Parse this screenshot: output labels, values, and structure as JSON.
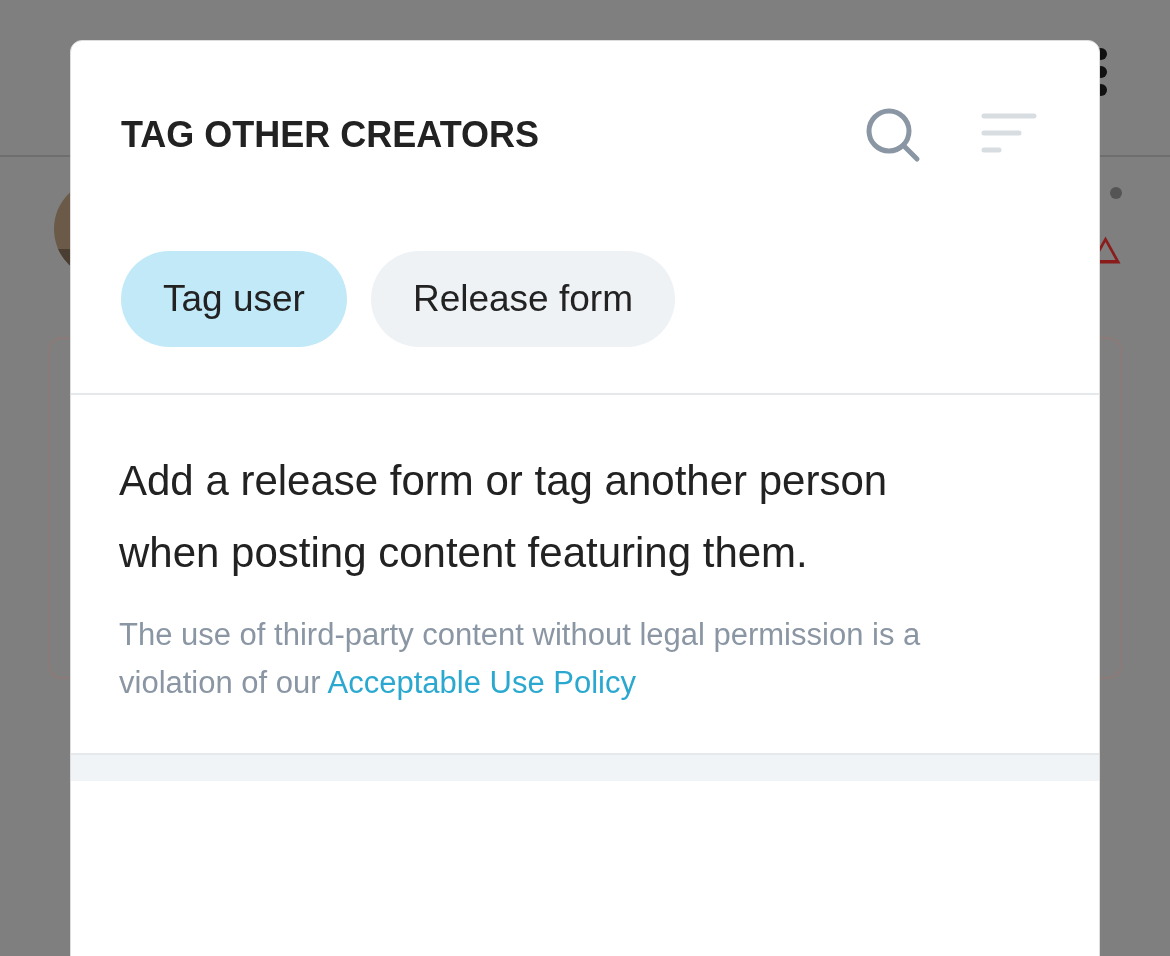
{
  "dialog": {
    "title": "TAG OTHER CREATORS",
    "tabs": [
      {
        "label": "Tag user",
        "selected": true
      },
      {
        "label": "Release form",
        "selected": false
      }
    ],
    "description": "Add a release form or tag another person when posting content featuring them.",
    "note": "The use of third-party content without legal permission is a violation of our",
    "note_link": "Acceptable Use Policy"
  }
}
